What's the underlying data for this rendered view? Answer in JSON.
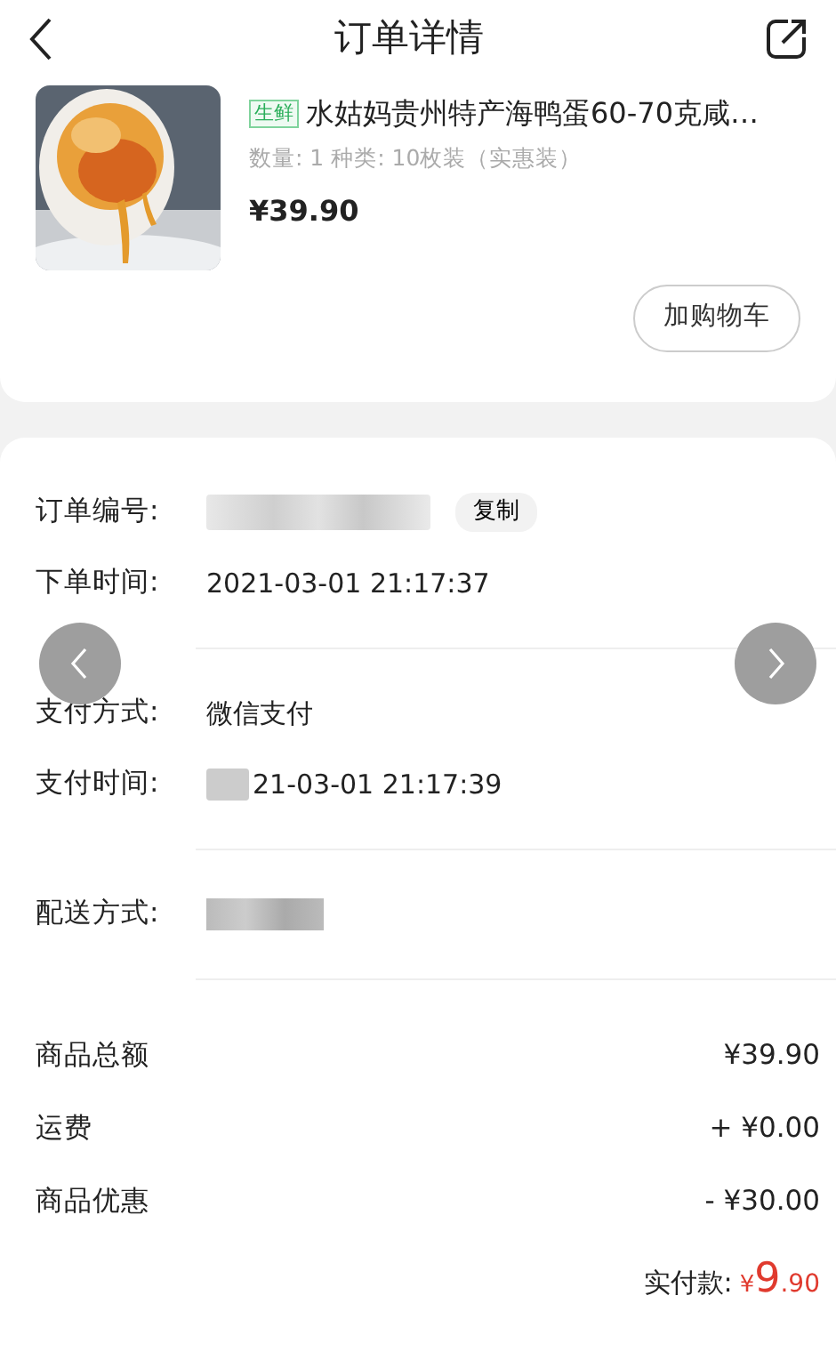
{
  "header": {
    "title": "订单详情"
  },
  "product": {
    "kind": "picture",
    "tag": "生鲜",
    "name": "水姑妈贵州特产海鸭蛋60-70克咸…",
    "spec": "数量: 1  种类: 10枚装（实惠装）",
    "price": "¥39.90",
    "button": "加购物车"
  },
  "info_groups": [
    [
      {
        "label": "订单编号:",
        "blurred": true,
        "action": "复制"
      },
      {
        "label": "下单时间:",
        "value": "2021-03-01 21:17:37",
        "blurred": false
      }
    ],
    [
      {
        "label": "支付方式:",
        "value": "微信支付",
        "blurred": false
      },
      {
        "label": "支付时间:",
        "value": "21-03-01 21:17:39",
        "blurred": true
      }
    ],
    [
      {
        "label": "配送方式:",
        "blurred": true
      }
    ]
  ],
  "summary": [
    {
      "label": "商品总额",
      "value": "¥39.90"
    },
    {
      "label": "运费",
      "value": "+ ¥0.00"
    },
    {
      "label": "商品优惠",
      "value": "- ¥30.00"
    }
  ],
  "total": {
    "label": "实付款:",
    "currency": "¥",
    "integer": "9",
    "decimal": ".90"
  }
}
